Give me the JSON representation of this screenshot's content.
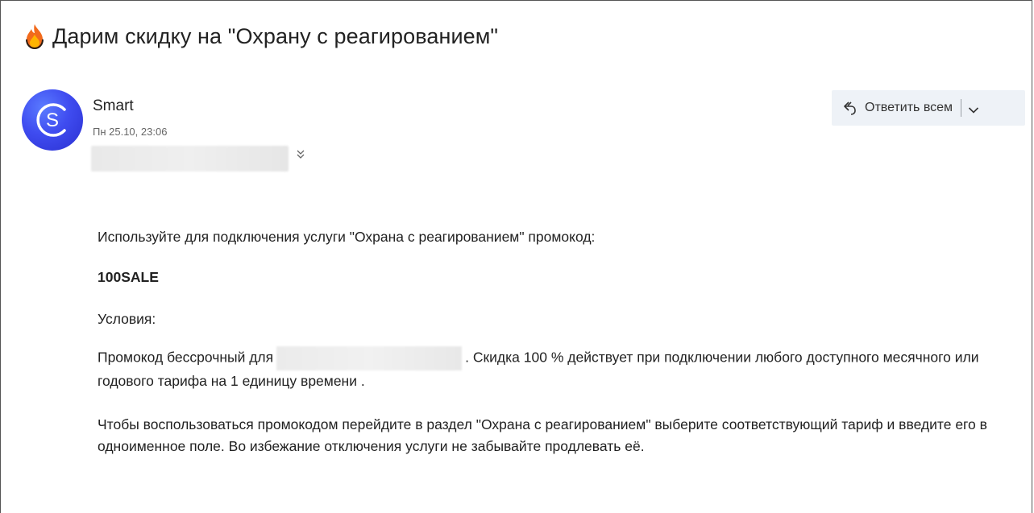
{
  "email": {
    "subject": "Дарим скидку на \"Охрану с реагированием\"",
    "sender": {
      "name": "Smart",
      "date": "Пн 25.10, 23:06",
      "avatar_letter": "S",
      "avatar_color": "#3f4cf0"
    },
    "reply_all_label": "Ответить всем",
    "body": {
      "p1": "Используйте для подключения услуги \"Охрана с реагированием\" промокод:",
      "code": "100SALE",
      "conditions_label": "Условия:",
      "p3_before": "Промокод бессрочный для",
      "p3_after": ". Скидка 100 % действует при подключении любого доступного месячного или годового тарифа на 1 единицу времени .",
      "p4": "Чтобы воспользоваться промокодом перейдите в раздел \"Охрана с реагированием\" выберите соответствующий тариф и введите его в одноименное поле. Во избежание отключения услуги не забывайте продлевать её."
    }
  },
  "icons": {
    "subject": "fire-icon",
    "reply": "reply-all-icon",
    "dropdown": "chevron-down-icon",
    "expand": "double-chevron-down-icon"
  }
}
